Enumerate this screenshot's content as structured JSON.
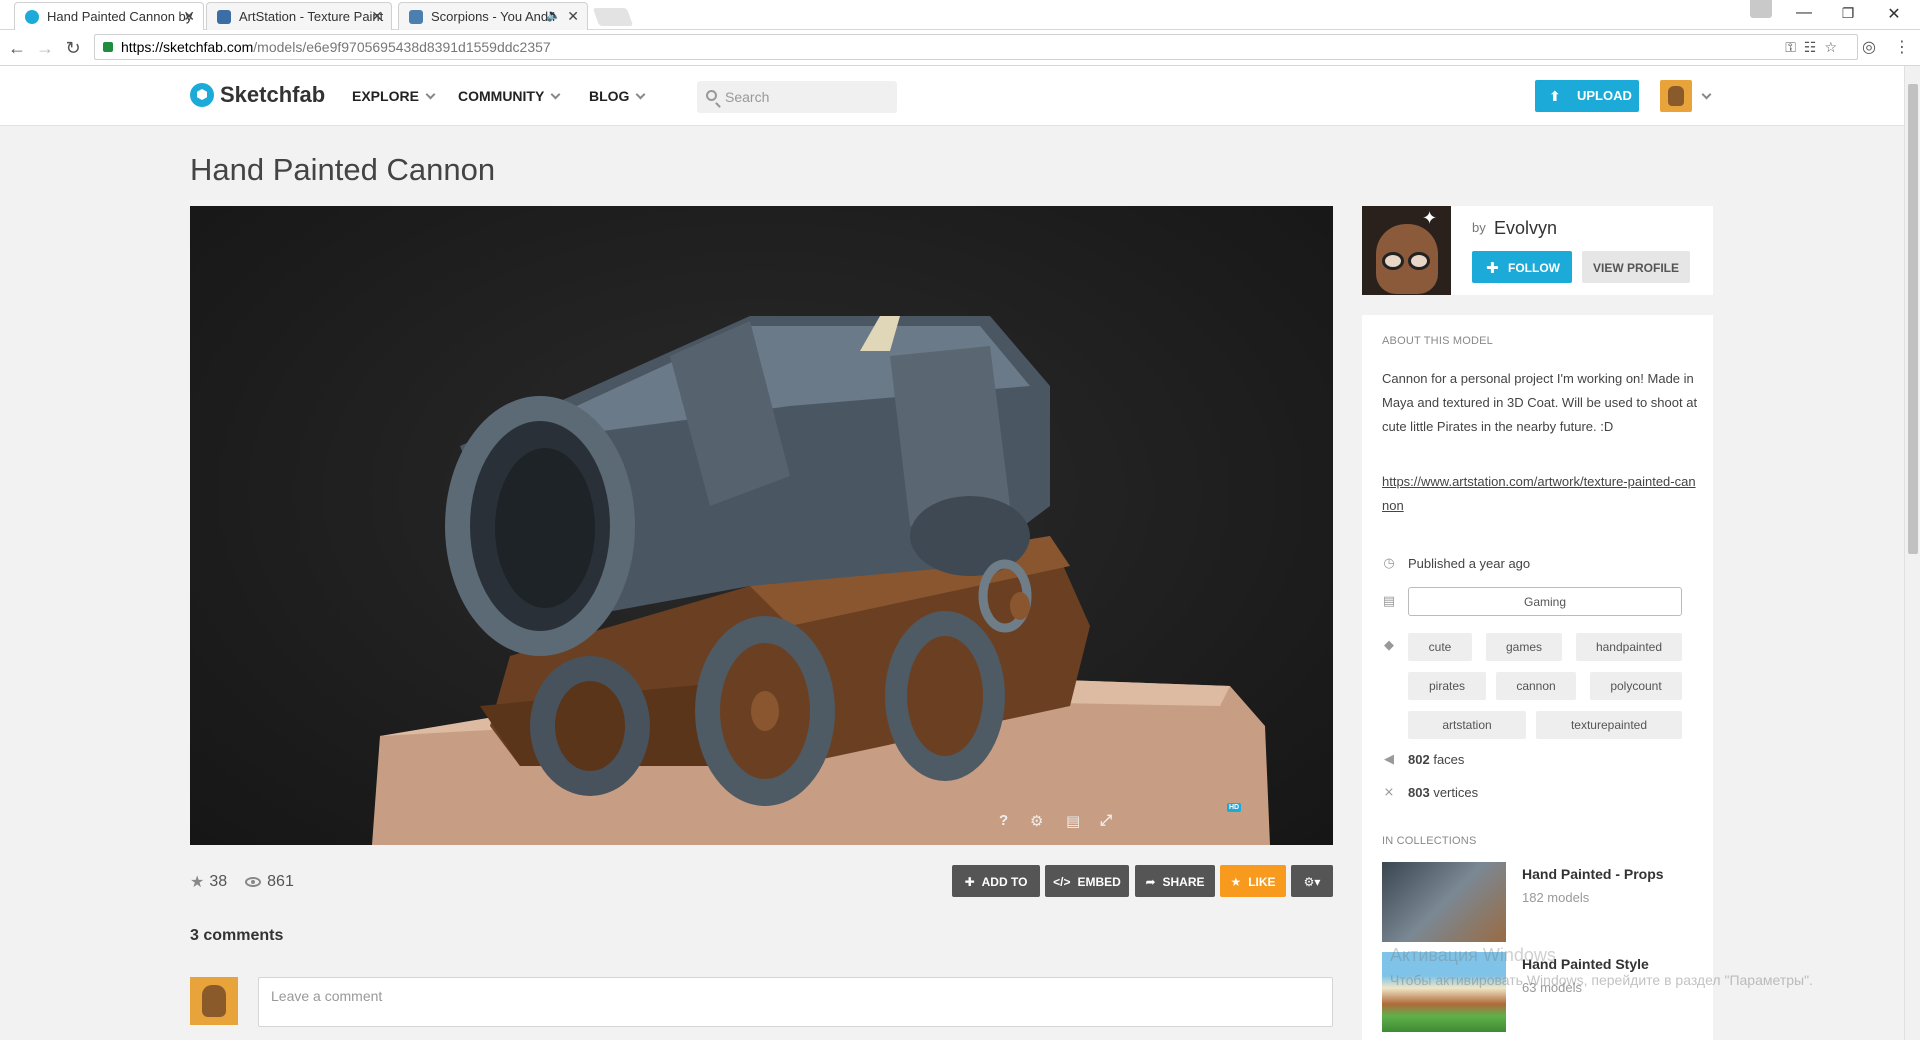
{
  "browser": {
    "tabs": [
      {
        "title": "Hand Painted Cannon by",
        "active": true,
        "close": "✕"
      },
      {
        "title": "ArtStation - Texture Paint",
        "active": false,
        "close": "✕"
      },
      {
        "title": "Scorpions - You And I",
        "active": false,
        "close": "✕",
        "muted_icon": "speaker-icon"
      }
    ],
    "window_controls": {
      "minimize": "—",
      "restore": "❐",
      "close": "✕"
    },
    "url_host": "https://sketchfab.com",
    "url_path": "/models/e6e9f9705695438d8391d1559ddc2357"
  },
  "header": {
    "logo_text": "Sketchfab",
    "nav": [
      "EXPLORE",
      "COMMUNITY",
      "BLOG"
    ],
    "search_placeholder": "Search",
    "upload_label": "UPLOAD"
  },
  "model": {
    "title": "Hand Painted Cannon",
    "likes": "38",
    "views": "861",
    "viewer_controls": {
      "help": "?",
      "hd_badge": "HD"
    }
  },
  "actions": {
    "add_to": "ADD TO",
    "embed": "EMBED",
    "share": "SHARE",
    "like": "LIKE"
  },
  "comments": {
    "title": "3 comments",
    "placeholder": "Leave a comment"
  },
  "author": {
    "by": "by",
    "name": "Evolvyn",
    "follow_label": "FOLLOW",
    "view_profile_label": "VIEW PROFILE"
  },
  "about": {
    "label": "ABOUT THIS MODEL",
    "description": "Cannon for a personal project I'm working on! Made in Maya and textured in 3D Coat. Will be used to shoot at cute little Pirates in the nearby future. :D",
    "link": "https://www.artstation.com/artwork/texture-painted-cannon",
    "published": "Published a year ago",
    "category": "Gaming",
    "tags": [
      "cute",
      "games",
      "handpainted",
      "pirates",
      "cannon",
      "polycount",
      "artstation",
      "texturepainted"
    ],
    "faces_count": "802",
    "faces_label": "faces",
    "vertices_count": "803",
    "vertices_label": "vertices"
  },
  "collections": {
    "label": "IN COLLECTIONS",
    "items": [
      {
        "title": "Hand Painted - Props",
        "count": "182 models"
      },
      {
        "title": "Hand Painted Style",
        "count": "63 models"
      }
    ]
  },
  "os_watermark": {
    "line1": "Активация Windows",
    "line2": "Чтобы активировать Windows, перейдите в раздел \"Параметры\"."
  },
  "colors": {
    "accent": "#1caad9",
    "like": "#f79a1e",
    "button_dark": "#555555"
  }
}
